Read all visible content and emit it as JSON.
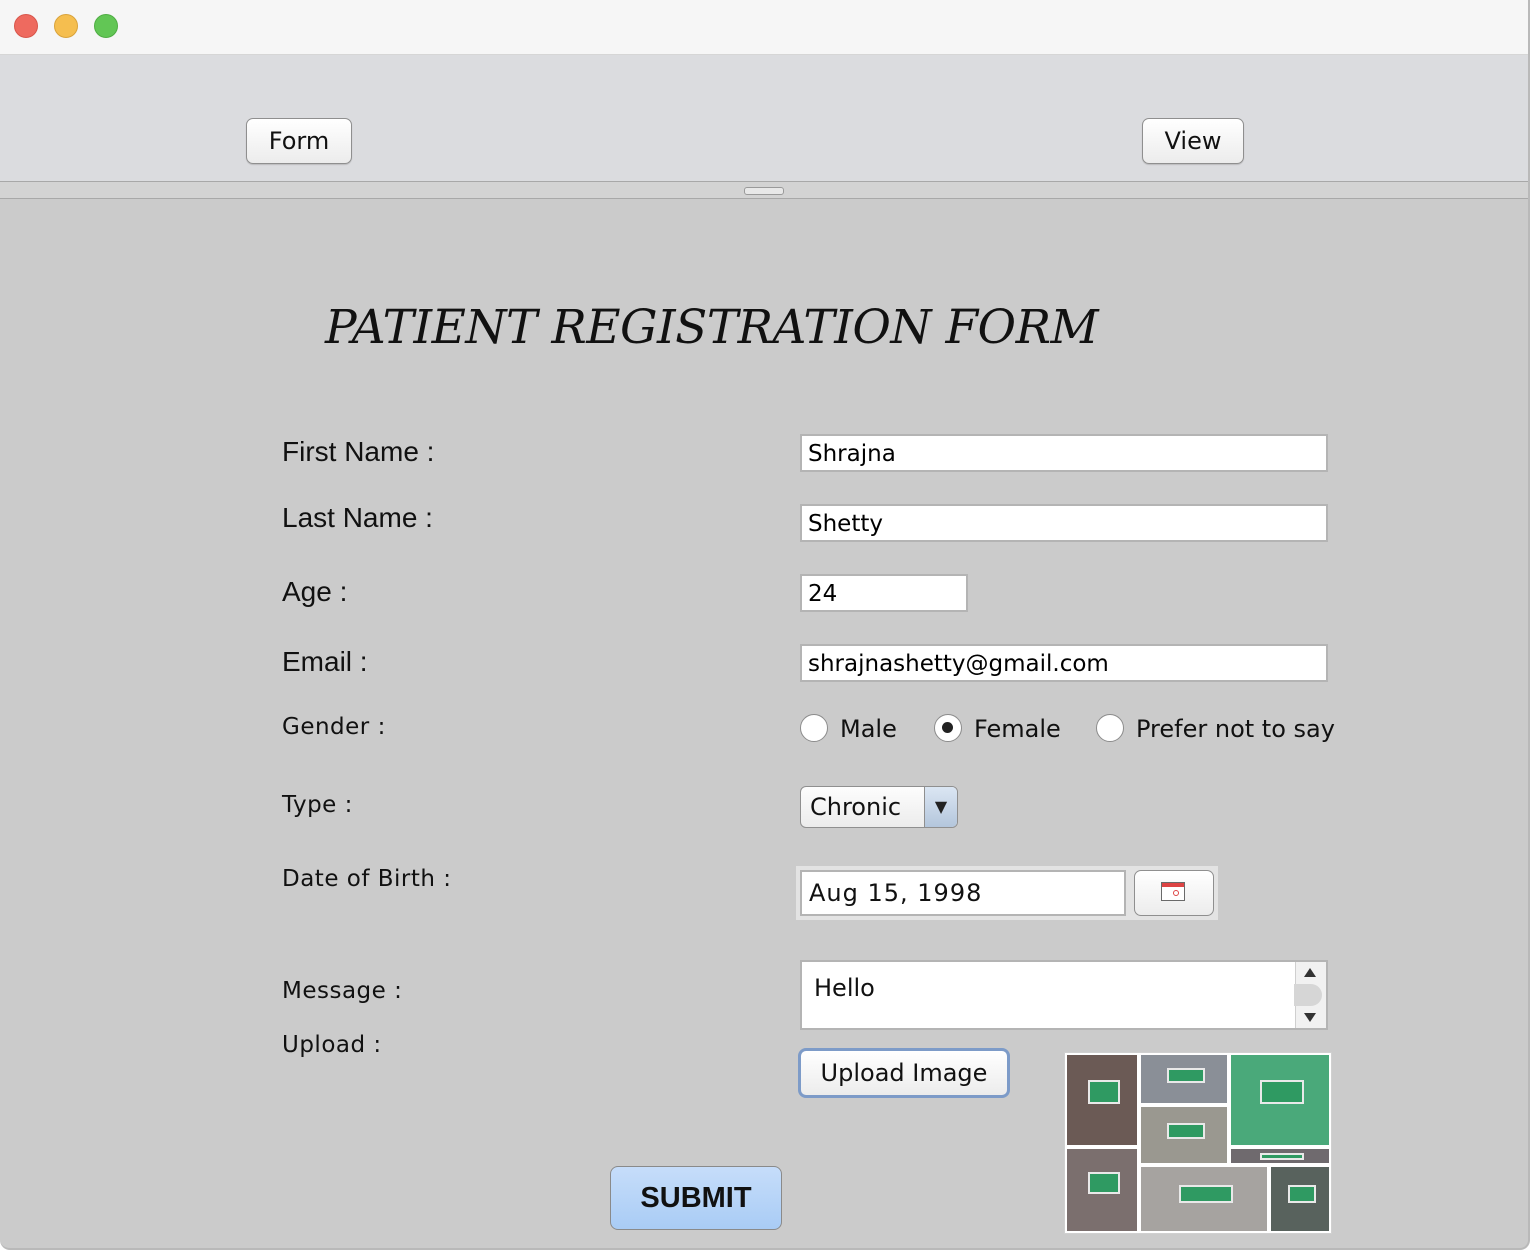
{
  "nav": {
    "form_label": "Form",
    "view_label": "View"
  },
  "form": {
    "title": "PATIENT REGISTRATION FORM",
    "labels": {
      "first_name": "First Name :",
      "last_name": "Last Name :",
      "age": "Age :",
      "email": "Email :",
      "gender": "Gender :",
      "type": "Type :",
      "dob": "Date of Birth :",
      "message": "Message :",
      "upload": "Upload :"
    },
    "values": {
      "first_name": "Shrajna",
      "last_name": "Shetty",
      "age": "24",
      "email": "shrajnashetty@gmail.com",
      "type": "Chronic",
      "dob": "Aug 15, 1998",
      "message": "Hello"
    },
    "gender_options": [
      "Male",
      "Female",
      "Prefer not to say"
    ],
    "gender_selected": "Female",
    "upload_button": "Upload Image",
    "submit_button": "SUBMIT"
  },
  "icons": {
    "calendar": "calendar-icon",
    "dropdown": "chevron-down-icon"
  },
  "colors": {
    "submit_bg": "#a9ccf5",
    "window_bg": "#cbcbcb",
    "close": "#ee6a5f",
    "minimize": "#f5be4f",
    "zoom": "#62c655"
  }
}
